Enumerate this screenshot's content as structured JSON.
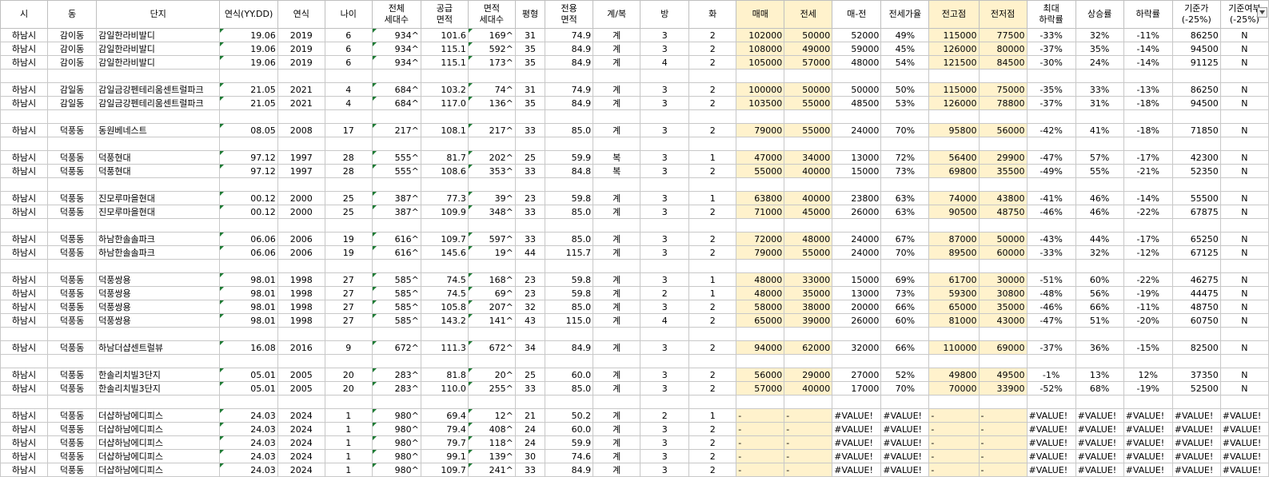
{
  "headers": [
    "시",
    "동",
    "단지",
    "연식(YY.DD)",
    "연식",
    "나이",
    "전체\n세대수",
    "공급\n면적",
    "면적\n세대수",
    "평형",
    "전용\n면적",
    "계/복",
    "방",
    "화",
    "매매",
    "전세",
    "매-전",
    "전세가율",
    "전고점",
    "전저점",
    "최대\n하락률",
    "상승률",
    "하락률",
    "기준가\n(-25%)",
    "기준여부\n(-25%)"
  ],
  "highlight_columns": [
    14,
    15,
    18,
    19
  ],
  "highlight_color": "#fff2cc",
  "filter_column": 2,
  "rows": [
    [
      "하남시",
      "감이동",
      "감일한라비발디",
      "19.06",
      "2019",
      "6",
      "934^",
      "101.6",
      "169^",
      "31",
      "74.9",
      "계",
      "3",
      "2",
      "102000",
      "50000",
      "52000",
      "49%",
      "115000",
      "77500",
      "-33%",
      "32%",
      "-11%",
      "86250",
      "N"
    ],
    [
      "하남시",
      "감이동",
      "감일한라비발디",
      "19.06",
      "2019",
      "6",
      "934^",
      "115.1",
      "592^",
      "35",
      "84.9",
      "계",
      "3",
      "2",
      "108000",
      "49000",
      "59000",
      "45%",
      "126000",
      "80000",
      "-37%",
      "35%",
      "-14%",
      "94500",
      "N"
    ],
    [
      "하남시",
      "감이동",
      "감일한라비발디",
      "19.06",
      "2019",
      "6",
      "934^",
      "115.1",
      "173^",
      "35",
      "84.9",
      "계",
      "4",
      "2",
      "105000",
      "57000",
      "48000",
      "54%",
      "121500",
      "84500",
      "-30%",
      "24%",
      "-14%",
      "91125",
      "N"
    ],
    null,
    [
      "하남시",
      "감일동",
      "감일금강펜테리움센트럴파크",
      "21.05",
      "2021",
      "4",
      "684^",
      "103.2",
      "74^",
      "31",
      "74.9",
      "계",
      "3",
      "2",
      "100000",
      "50000",
      "50000",
      "50%",
      "115000",
      "75000",
      "-35%",
      "33%",
      "-13%",
      "86250",
      "N"
    ],
    [
      "하남시",
      "감일동",
      "감일금강펜테리움센트럴파크",
      "21.05",
      "2021",
      "4",
      "684^",
      "117.0",
      "136^",
      "35",
      "84.9",
      "계",
      "3",
      "2",
      "103500",
      "55000",
      "48500",
      "53%",
      "126000",
      "78800",
      "-37%",
      "31%",
      "-18%",
      "94500",
      "N"
    ],
    null,
    [
      "하남시",
      "덕풍동",
      "동원베네스트",
      "08.05",
      "2008",
      "17",
      "217^",
      "108.1",
      "217^",
      "33",
      "85.0",
      "계",
      "3",
      "2",
      "79000",
      "55000",
      "24000",
      "70%",
      "95800",
      "56000",
      "-42%",
      "41%",
      "-18%",
      "71850",
      "N"
    ],
    null,
    [
      "하남시",
      "덕풍동",
      "덕풍현대",
      "97.12",
      "1997",
      "28",
      "555^",
      "81.7",
      "202^",
      "25",
      "59.9",
      "복",
      "3",
      "1",
      "47000",
      "34000",
      "13000",
      "72%",
      "56400",
      "29900",
      "-47%",
      "57%",
      "-17%",
      "42300",
      "N"
    ],
    [
      "하남시",
      "덕풍동",
      "덕풍현대",
      "97.12",
      "1997",
      "28",
      "555^",
      "108.6",
      "353^",
      "33",
      "84.8",
      "복",
      "3",
      "2",
      "55000",
      "40000",
      "15000",
      "73%",
      "69800",
      "35500",
      "-49%",
      "55%",
      "-21%",
      "52350",
      "N"
    ],
    null,
    [
      "하남시",
      "덕풍동",
      "진모루마을현대",
      "00.12",
      "2000",
      "25",
      "387^",
      "77.3",
      "39^",
      "23",
      "59.8",
      "계",
      "3",
      "1",
      "63800",
      "40000",
      "23800",
      "63%",
      "74000",
      "43800",
      "-41%",
      "46%",
      "-14%",
      "55500",
      "N"
    ],
    [
      "하남시",
      "덕풍동",
      "진모루마을현대",
      "00.12",
      "2000",
      "25",
      "387^",
      "109.9",
      "348^",
      "33",
      "85.0",
      "계",
      "3",
      "2",
      "71000",
      "45000",
      "26000",
      "63%",
      "90500",
      "48750",
      "-46%",
      "46%",
      "-22%",
      "67875",
      "N"
    ],
    null,
    [
      "하남시",
      "덕풍동",
      "하남한솔솔파크",
      "06.06",
      "2006",
      "19",
      "616^",
      "109.7",
      "597^",
      "33",
      "85.0",
      "계",
      "3",
      "2",
      "72000",
      "48000",
      "24000",
      "67%",
      "87000",
      "50000",
      "-43%",
      "44%",
      "-17%",
      "65250",
      "N"
    ],
    [
      "하남시",
      "덕풍동",
      "하남한솔솔파크",
      "06.06",
      "2006",
      "19",
      "616^",
      "145.6",
      "19^",
      "44",
      "115.7",
      "계",
      "3",
      "2",
      "79000",
      "55000",
      "24000",
      "70%",
      "89500",
      "60000",
      "-33%",
      "32%",
      "-12%",
      "67125",
      "N"
    ],
    null,
    [
      "하남시",
      "덕풍동",
      "덕풍쌍용",
      "98.01",
      "1998",
      "27",
      "585^",
      "74.5",
      "168^",
      "23",
      "59.8",
      "계",
      "3",
      "1",
      "48000",
      "33000",
      "15000",
      "69%",
      "61700",
      "30000",
      "-51%",
      "60%",
      "-22%",
      "46275",
      "N"
    ],
    [
      "하남시",
      "덕풍동",
      "덕풍쌍용",
      "98.01",
      "1998",
      "27",
      "585^",
      "74.5",
      "69^",
      "23",
      "59.8",
      "계",
      "2",
      "1",
      "48000",
      "35000",
      "13000",
      "73%",
      "59300",
      "30800",
      "-48%",
      "56%",
      "-19%",
      "44475",
      "N"
    ],
    [
      "하남시",
      "덕풍동",
      "덕풍쌍용",
      "98.01",
      "1998",
      "27",
      "585^",
      "105.8",
      "207^",
      "32",
      "85.0",
      "계",
      "3",
      "2",
      "58000",
      "38000",
      "20000",
      "66%",
      "65000",
      "35000",
      "-46%",
      "66%",
      "-11%",
      "48750",
      "N"
    ],
    [
      "하남시",
      "덕풍동",
      "덕풍쌍용",
      "98.01",
      "1998",
      "27",
      "585^",
      "143.2",
      "141^",
      "43",
      "115.0",
      "계",
      "4",
      "2",
      "65000",
      "39000",
      "26000",
      "60%",
      "81000",
      "43000",
      "-47%",
      "51%",
      "-20%",
      "60750",
      "N"
    ],
    null,
    [
      "하남시",
      "덕풍동",
      "하남더샵센트럴뷰",
      "16.08",
      "2016",
      "9",
      "672^",
      "111.3",
      "672^",
      "34",
      "84.9",
      "계",
      "3",
      "2",
      "94000",
      "62000",
      "32000",
      "66%",
      "110000",
      "69000",
      "-37%",
      "36%",
      "-15%",
      "82500",
      "N"
    ],
    null,
    [
      "하남시",
      "덕풍동",
      "한솔리치빌3단지",
      "05.01",
      "2005",
      "20",
      "283^",
      "81.8",
      "20^",
      "25",
      "60.0",
      "계",
      "3",
      "2",
      "56000",
      "29000",
      "27000",
      "52%",
      "49800",
      "49500",
      "-1%",
      "13%",
      "12%",
      "37350",
      "N"
    ],
    [
      "하남시",
      "덕풍동",
      "한솔리치빌3단지",
      "05.01",
      "2005",
      "20",
      "283^",
      "110.0",
      "255^",
      "33",
      "85.0",
      "계",
      "3",
      "2",
      "57000",
      "40000",
      "17000",
      "70%",
      "70000",
      "33900",
      "-52%",
      "68%",
      "-19%",
      "52500",
      "N"
    ],
    null,
    [
      "하남시",
      "덕풍동",
      "더샵하남에디피스",
      "24.03",
      "2024",
      "1",
      "980^",
      "69.4",
      "12^",
      "21",
      "50.2",
      "계",
      "2",
      "1",
      "-",
      "-",
      "#VALUE!",
      "#VALUE!",
      "-",
      "-",
      "#VALUE!",
      "#VALUE!",
      "#VALUE!",
      "#VALUE!",
      "#VALUE!"
    ],
    [
      "하남시",
      "덕풍동",
      "더샵하남에디피스",
      "24.03",
      "2024",
      "1",
      "980^",
      "79.4",
      "408^",
      "24",
      "60.0",
      "계",
      "3",
      "2",
      "-",
      "-",
      "#VALUE!",
      "#VALUE!",
      "-",
      "-",
      "#VALUE!",
      "#VALUE!",
      "#VALUE!",
      "#VALUE!",
      "#VALUE!"
    ],
    [
      "하남시",
      "덕풍동",
      "더샵하남에디피스",
      "24.03",
      "2024",
      "1",
      "980^",
      "79.7",
      "118^",
      "24",
      "59.9",
      "계",
      "3",
      "2",
      "-",
      "-",
      "#VALUE!",
      "#VALUE!",
      "-",
      "-",
      "#VALUE!",
      "#VALUE!",
      "#VALUE!",
      "#VALUE!",
      "#VALUE!"
    ],
    [
      "하남시",
      "덕풍동",
      "더샵하남에디피스",
      "24.03",
      "2024",
      "1",
      "980^",
      "99.1",
      "139^",
      "30",
      "74.6",
      "계",
      "3",
      "2",
      "-",
      "-",
      "#VALUE!",
      "#VALUE!",
      "-",
      "-",
      "#VALUE!",
      "#VALUE!",
      "#VALUE!",
      "#VALUE!",
      "#VALUE!"
    ],
    [
      "하남시",
      "덕풍동",
      "더샵하남에디피스",
      "24.03",
      "2024",
      "1",
      "980^",
      "109.7",
      "241^",
      "33",
      "84.9",
      "계",
      "3",
      "2",
      "-",
      "-",
      "#VALUE!",
      "#VALUE!",
      "-",
      "-",
      "#VALUE!",
      "#VALUE!",
      "#VALUE!",
      "#VALUE!",
      "#VALUE!"
    ]
  ],
  "icons": {
    "filter": "filter-dropdown-icon",
    "comment": "cell-indicator-triangle"
  }
}
